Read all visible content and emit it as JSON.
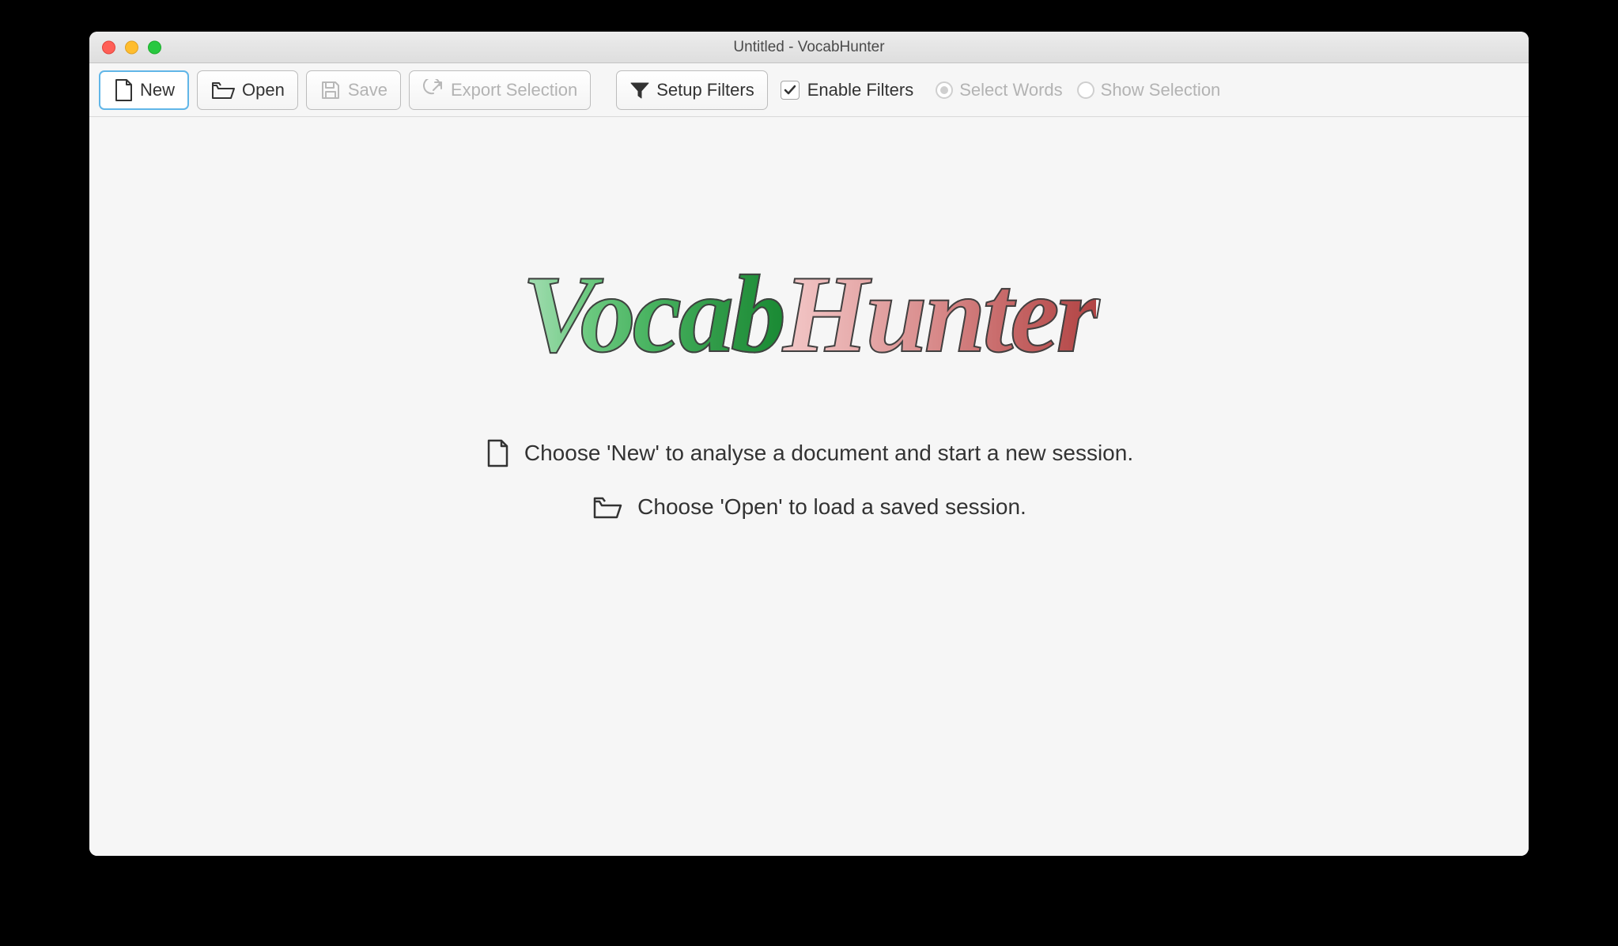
{
  "window": {
    "title": "Untitled - VocabHunter"
  },
  "toolbar": {
    "new_label": "New",
    "open_label": "Open",
    "save_label": "Save",
    "export_label": "Export Selection",
    "setup_filters_label": "Setup Filters",
    "enable_filters_label": "Enable Filters",
    "enable_filters_checked": true,
    "select_words_label": "Select Words",
    "show_selection_label": "Show Selection"
  },
  "main": {
    "logo_left": "Vocab",
    "logo_right": "Hunter",
    "hint_new": "Choose 'New' to analyse a document and start a new session.",
    "hint_open": "Choose 'Open' to load a saved session."
  }
}
